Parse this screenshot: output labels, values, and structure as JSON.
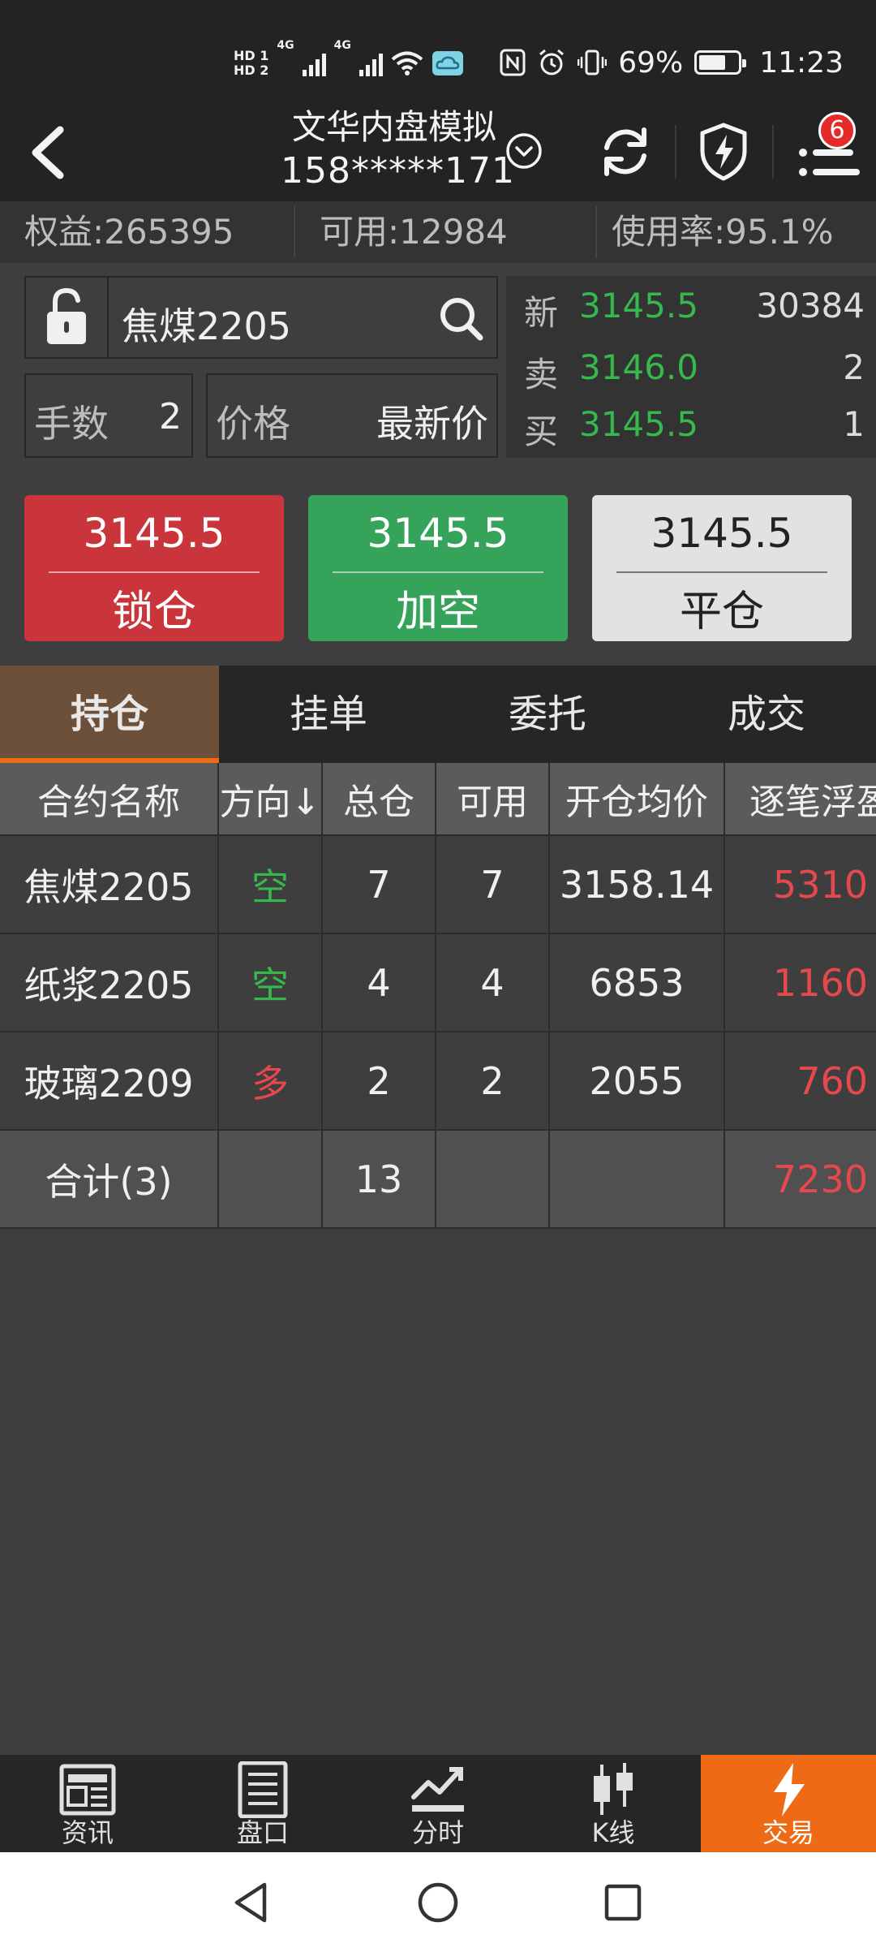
{
  "status_bar": {
    "hd1": "HD 1",
    "hd2": "HD 2",
    "net1": "4G",
    "net2": "4G",
    "battery_percent": "69%",
    "battery_level": 0.69,
    "time": "11:23"
  },
  "header": {
    "title": "文华内盘模拟",
    "account": "158*****171",
    "notification_count": "6"
  },
  "summary": {
    "equity": "权益:265395",
    "available": "可用:12984",
    "usage": "使用率:95.1%"
  },
  "order": {
    "symbol": "焦煤2205",
    "lots_label": "手数",
    "lots_value": "2",
    "price_label": "价格",
    "price_value": "最新价"
  },
  "quote": {
    "last_label": "新",
    "last_price": "3145.5",
    "last_volume": "30384",
    "ask_label": "卖",
    "ask_price": "3146.0",
    "ask_volume": "2",
    "bid_label": "买",
    "bid_price": "3145.5",
    "bid_volume": "1"
  },
  "actions": {
    "lock": {
      "price": "3145.5",
      "label": "锁仓"
    },
    "add_short": {
      "price": "3145.5",
      "label": "加空"
    },
    "close": {
      "price": "3145.5",
      "label": "平仓"
    }
  },
  "tabs": [
    "持仓",
    "挂单",
    "委托",
    "成交"
  ],
  "table": {
    "columns": [
      "合约名称",
      "方向↓",
      "总仓",
      "可用",
      "开仓均价",
      "逐笔浮盈"
    ],
    "rows": [
      {
        "name": "焦煤2205",
        "direction": "空",
        "total": "7",
        "available": "7",
        "avg_price": "3158.14",
        "float_pnl": "5310"
      },
      {
        "name": "纸浆2205",
        "direction": "空",
        "total": "4",
        "available": "4",
        "avg_price": "6853",
        "float_pnl": "1160"
      },
      {
        "name": "玻璃2209",
        "direction": "多",
        "total": "2",
        "available": "2",
        "avg_price": "2055",
        "float_pnl": "760"
      }
    ],
    "total_row": {
      "name": "合计(3)",
      "total": "13",
      "float_pnl": "7230"
    }
  },
  "bottom_nav": [
    "资讯",
    "盘口",
    "分时",
    "K线",
    "交易"
  ],
  "colors": {
    "up_red": "#e5484d",
    "down_green": "#36b84c",
    "accent_orange": "#ee6a14"
  }
}
